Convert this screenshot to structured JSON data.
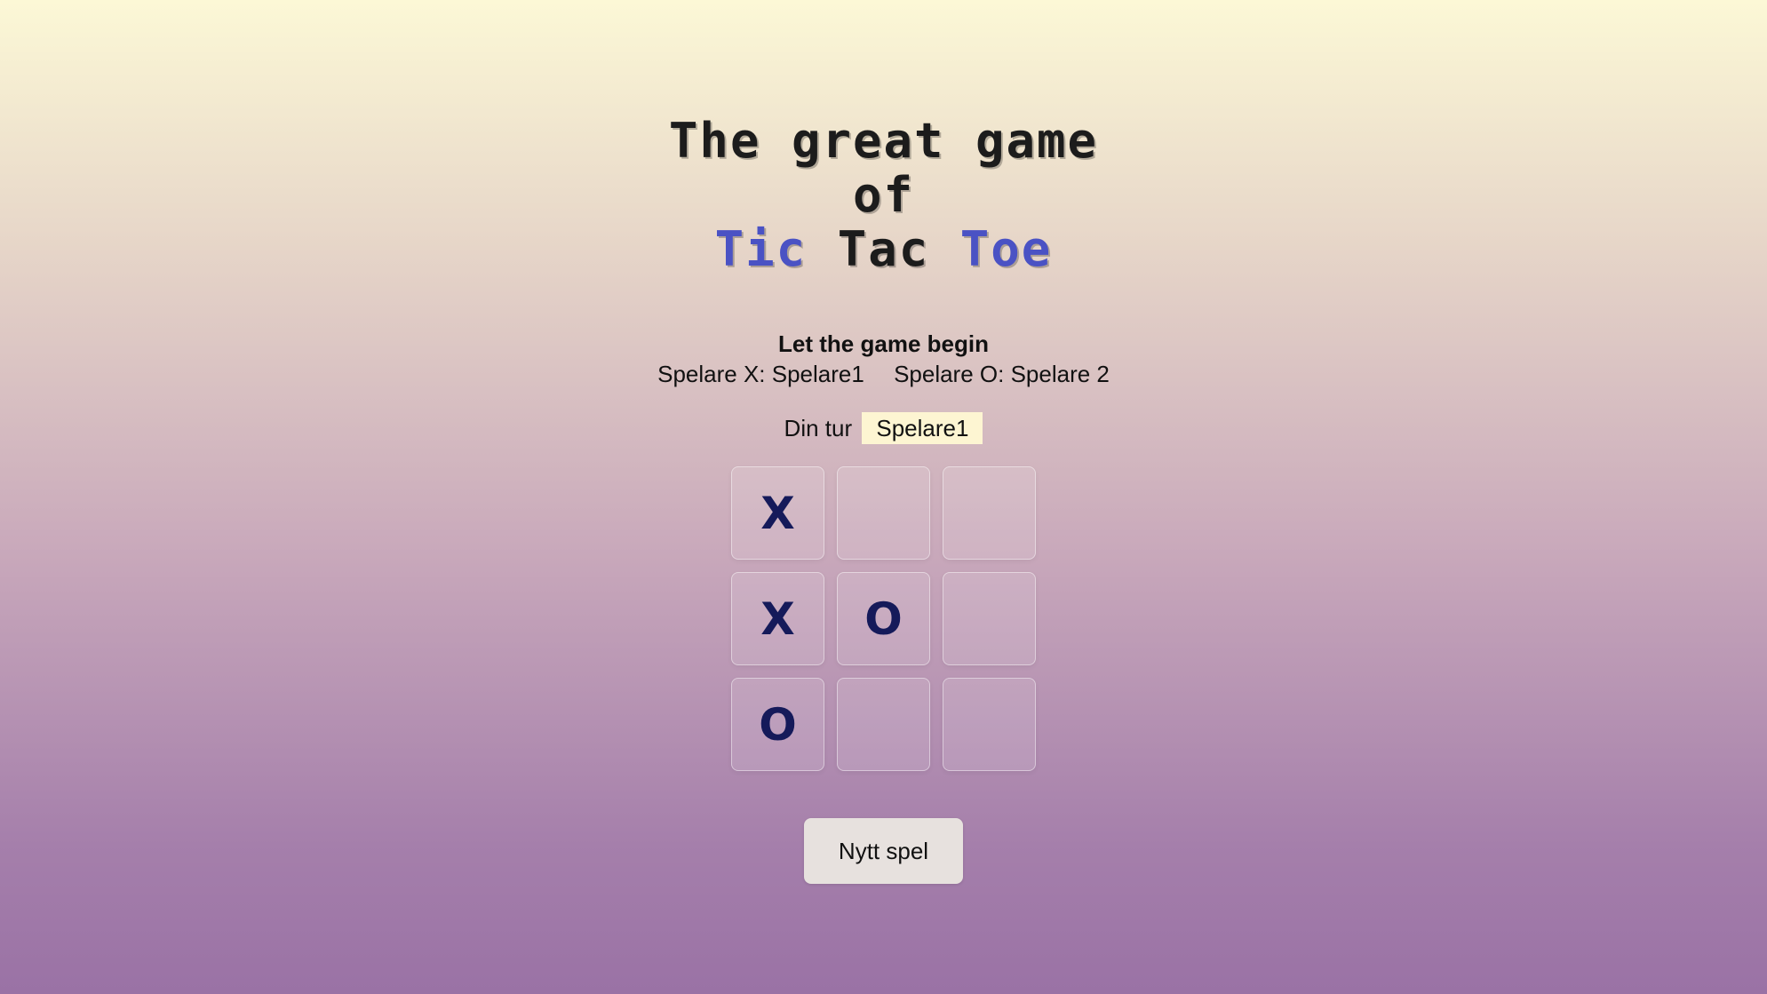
{
  "title": {
    "line1": "The great game",
    "line2": "of",
    "line3": {
      "word1": "Tic",
      "word2": "Tac",
      "word3": "Toe"
    }
  },
  "info": {
    "heading": "Let the game begin",
    "player_x": "Spelare X: Spelare1",
    "player_o": "Spelare O: Spelare 2"
  },
  "turn": {
    "label": "Din tur",
    "current_player": "Spelare1"
  },
  "board": {
    "cells": [
      "X",
      "",
      "",
      "X",
      "O",
      "",
      "O",
      "",
      ""
    ]
  },
  "actions": {
    "new_game_label": "Nytt spel"
  },
  "colors": {
    "accent_blue": "#4a52c4",
    "mark_color": "#151a5a",
    "turn_highlight": "#fdf5d2"
  }
}
